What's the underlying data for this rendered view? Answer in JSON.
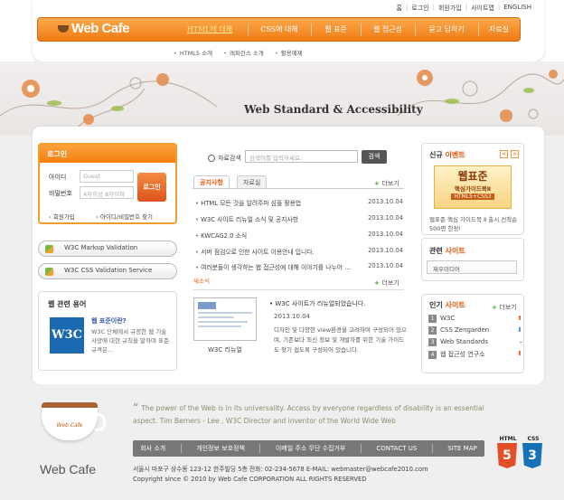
{
  "util_nav": [
    "홈",
    "로그인",
    "회원가입",
    "사이트맵",
    "ENGLISH"
  ],
  "logo": "Web Cafe",
  "gnb": [
    "HTML에 대해",
    "CSS에 대해",
    "웹 표준",
    "웹 접근성",
    "묻고 답하기",
    "자료실"
  ],
  "sub_nav": [
    "HTML5 소개",
    "레퍼런스 소개",
    "활용예제"
  ],
  "visual_title": "Web Standard & Accessibility",
  "login": {
    "title": "로그인",
    "id_label": "아이디",
    "id_placeholder": "Guest",
    "pw_label": "비밀번호",
    "pw_placeholder": "4자이상 8자이하",
    "button": "로그인",
    "join": "회원가입",
    "find": "아이디/비밀번호 찾기"
  },
  "validation": [
    "W3C Markup Validation",
    "W3C CSS Validation Service"
  ],
  "terms": {
    "title": "웹 관련 용어",
    "logo": "W3C",
    "question": "웹 표준이란?",
    "text": "W3C 단체에서 규정한 웹 기술 사양에 대한 규칙을 말하며 표준 규격은..."
  },
  "search": {
    "label": "자료검색",
    "placeholder": "검색어를 입력하세요.",
    "button": "검색"
  },
  "tabs": [
    "공지사항",
    "자료실"
  ],
  "more": "더보기",
  "notices": [
    {
      "title": "HTML 모든 것을 알려주마 섬플 활용법",
      "date": "2013.10.04"
    },
    {
      "title": "W3C 사이트 리뉴얼 소식 및 공지사항",
      "date": "2013.10.04"
    },
    {
      "title": "KWCAG2.0 소식",
      "date": "2013.10.04"
    },
    {
      "title": "서버 점검으로 인한 사이트 이용안내 입니다.",
      "date": "2013.10.04"
    },
    {
      "title": "여러분들이 생각하는 웹 접근성에 대해 이야기를 나누어 ...",
      "date": "2013.10.04"
    }
  ],
  "new_tag": "새소식",
  "feature": {
    "caption": "W3C 리뉴얼",
    "title": "W3C 사이트가 리뉴얼되었습니다.",
    "date": "2013.10.04",
    "text": "디자인 및 다양한 view환경을 고려하여 구성되어 있으며, 기존보다 최신 정보 및 개발자를 위한 기술 가이드도 찾기 쉽도록 구성되어 있습니다."
  },
  "event": {
    "title_a": "신규",
    "title_b": "이벤트",
    "prev": "<",
    "next": ">",
    "banner_l1": "웹표준",
    "banner_l2": "핵심가이드북Ⅱ",
    "banner_l3": "HTML5+CSS3",
    "text": "웹표준 핵심 가이드북 Ⅱ 출시 선착순 500명 한정!"
  },
  "related": {
    "title_a": "관련",
    "title_b": "사이트",
    "button": "제우미디어"
  },
  "popular": {
    "title_a": "인기",
    "title_b": "사이트",
    "items": [
      {
        "num": "1",
        "name": "W3C",
        "trend": "up",
        "arrow": "⬆"
      },
      {
        "num": "2",
        "name": "CSS Zengarden",
        "trend": "down",
        "arrow": "⬇"
      },
      {
        "num": "3",
        "name": "Web Standards",
        "trend": "same",
        "arrow": "–"
      },
      {
        "num": "4",
        "name": "웹 접근성 연구소",
        "trend": "up",
        "arrow": "⬆"
      }
    ]
  },
  "quote": "The power of the Web is in its universality. Access by everyone regardless of disability is an essential aspect. Tim Berners - Lee , W3C Director and inventor of the World Wide Web",
  "footer_nav": [
    "회사 소개",
    "개인정보 보호정책",
    "이메일 주소 무단 수집거부",
    "CONTACT US",
    "SITE MAP"
  ],
  "footer_logo": "Web Cafe",
  "cup_label": "Web Cafe",
  "address": "서울시 마포구 상수동 123-12 한주빌딩 5층    전화: 02-234-5678    E-MAIL: webmaster@webcafe2010.com",
  "copyright": "Copyright since © 2010 by Web Cafe CORPORATION ALL RIGHTS RESERVED",
  "badges": [
    {
      "label": "HTML",
      "glyph": "5",
      "color": "#e34f26"
    },
    {
      "label": "CSS",
      "glyph": "3",
      "color": "#1572b6"
    }
  ],
  "colors": {
    "accent": "#f27c10",
    "link": "#e5580b"
  }
}
